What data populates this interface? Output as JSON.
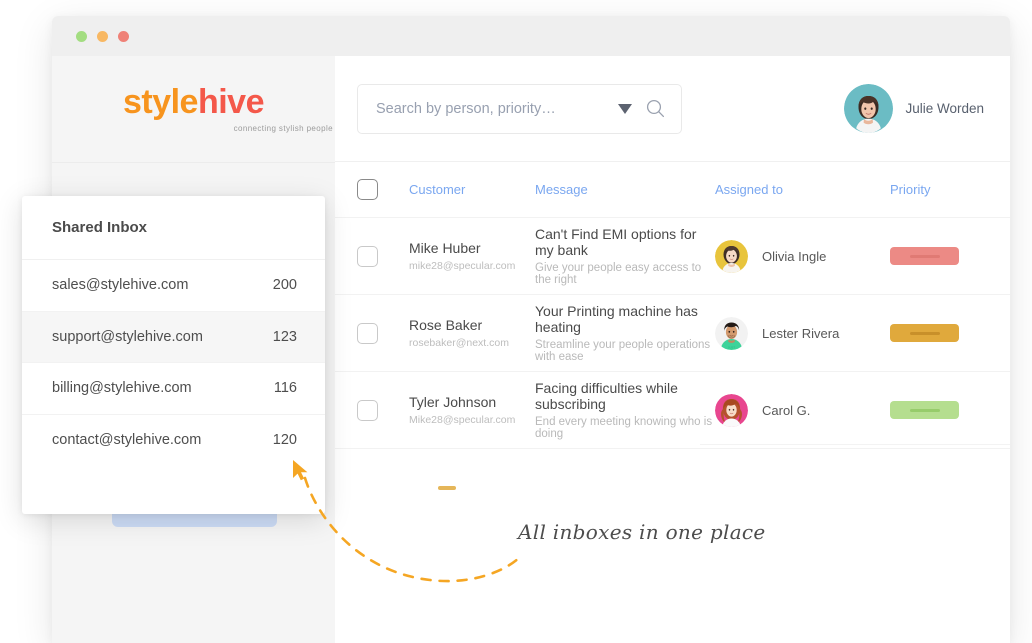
{
  "window": {
    "dots": [
      "close-green",
      "minimize-amber",
      "maximize-red"
    ]
  },
  "brand": {
    "name_part1": "style",
    "name_part2": "hive",
    "tagline": "connecting stylish people",
    "color_part1": "#F7941E",
    "color_part2": "#F4584A"
  },
  "search": {
    "placeholder": "Search by person, priority…",
    "value": "",
    "caret_icon": "chevron-down-icon",
    "icon": "search-icon"
  },
  "user": {
    "name": "Julie Worden",
    "avatar": "avatar-julie"
  },
  "table": {
    "headers": {
      "customer": "Customer",
      "message": "Message",
      "assigned_to": "Assigned to",
      "priority": "Priority"
    },
    "header_color": "#7aa7f0",
    "rows": [
      {
        "customer_name": "Mike Huber",
        "customer_email": "mike28@specular.com",
        "message_title": "Can't Find EMI options for my bank",
        "message_sub": "Give your people easy access to the right",
        "assignee": "Olivia Ingle",
        "priority_color": "#ec8a85",
        "priority_bar_color": "#e07a74"
      },
      {
        "customer_name": "Rose Baker",
        "customer_email": "rosebaker@next.com",
        "message_title": "Your Printing machine has heating",
        "message_sub": "Streamline your people operations with ease",
        "assignee": "Lester Rivera",
        "priority_color": "#e0a93c",
        "priority_bar_color": "#c8902a"
      },
      {
        "customer_name": "Tyler Johnson",
        "customer_email": "Mike28@specular.com",
        "message_title": "Facing difficulties while subscribing",
        "message_sub": "End every meeting knowing who is doing",
        "assignee": "Carol G.",
        "priority_color": "#b5de8f",
        "priority_bar_color": "#97cc6b"
      }
    ]
  },
  "shared_inbox": {
    "title": "Shared Inbox",
    "items": [
      {
        "address": "sales@stylehive.com",
        "count": "200",
        "active": false
      },
      {
        "address": "support@stylehive.com",
        "count": "123",
        "active": true
      },
      {
        "address": "billing@stylehive.com",
        "count": "116",
        "active": false
      },
      {
        "address": "contact@stylehive.com",
        "count": "120",
        "active": false
      }
    ]
  },
  "annotation": {
    "caption": "All inboxes in one place",
    "accent_color": "#F5A623",
    "cursor_icon": "cursor-arrow-icon"
  }
}
